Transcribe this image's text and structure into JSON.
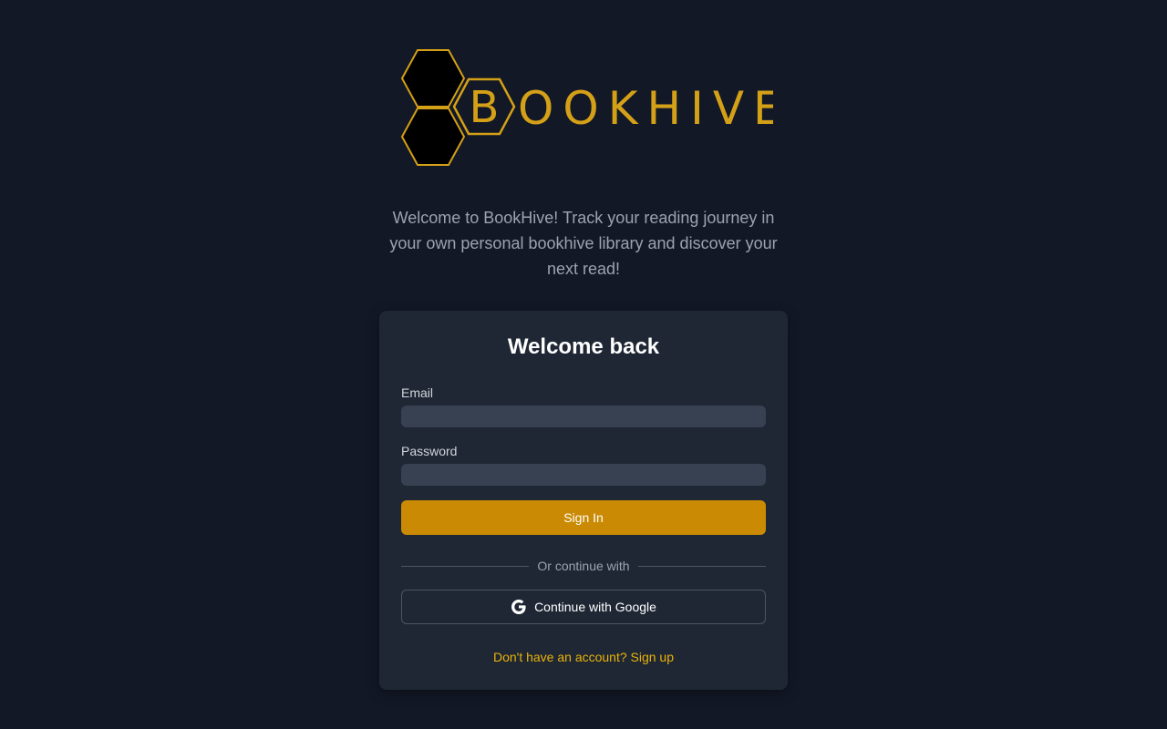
{
  "brand": {
    "logo_letter": "B",
    "logo_text": "OOKHIVE",
    "logo_color": "#d4a017"
  },
  "tagline": "Welcome to BookHive! Track your reading journey in your own personal bookhive library and discover your next read!",
  "login_card": {
    "title": "Welcome back",
    "email": {
      "label": "Email",
      "value": "",
      "placeholder": ""
    },
    "password": {
      "label": "Password",
      "value": "",
      "placeholder": ""
    },
    "sign_in_label": "Sign In",
    "divider_text": "Or continue with",
    "google_label": "Continue with Google",
    "google_icon": "google-g-icon",
    "signup_text": "Don't have an account? Sign up"
  },
  "colors": {
    "background": "#121826",
    "card": "#1f2735",
    "input": "#374151",
    "accent_button": "#ca8a04",
    "link": "#eab308"
  }
}
